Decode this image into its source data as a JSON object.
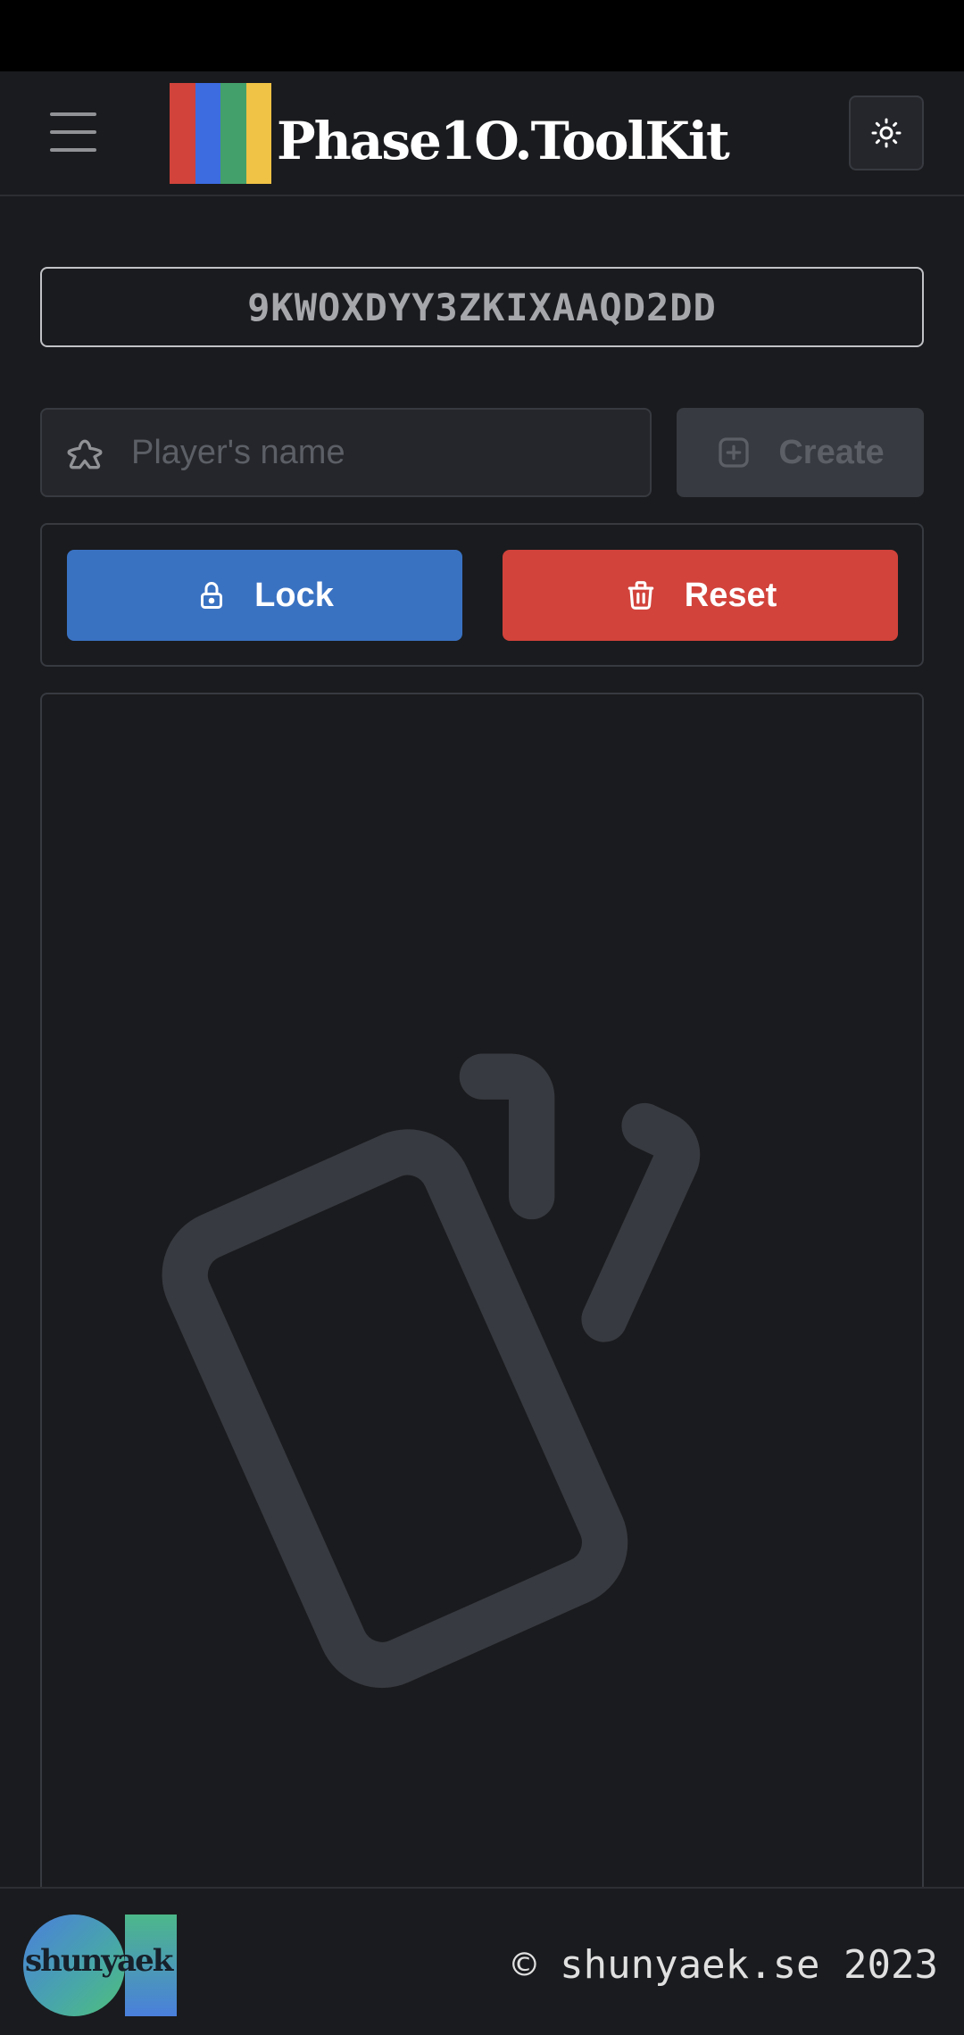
{
  "header": {
    "brand": "Phase1O.ToolKit",
    "menu_icon": "hamburger-menu-icon",
    "theme_icon": "sun-icon",
    "logo_colors": [
      "#d1433b",
      "#3d6ce0",
      "#44a06a",
      "#f0c245"
    ]
  },
  "session": {
    "code": "9KWOXDYY3ZKIXAAQD2DD"
  },
  "player_form": {
    "name_placeholder": "Player's name",
    "name_value": "",
    "name_icon": "meeple-icon",
    "create_label": "Create",
    "create_icon": "square-plus-icon"
  },
  "actions": {
    "lock_label": "Lock",
    "lock_icon": "lock-icon",
    "reset_label": "Reset",
    "reset_icon": "trash-icon"
  },
  "empty_state": {
    "icon": "cards-icon"
  },
  "footer": {
    "logo_text": "shunyaek",
    "copyright": "© shunyaek.se 2023"
  },
  "colors": {
    "background": "#1a1b1e",
    "lock": "#3a72c2",
    "reset": "#d1433b",
    "create_disabled": "#373a40"
  }
}
